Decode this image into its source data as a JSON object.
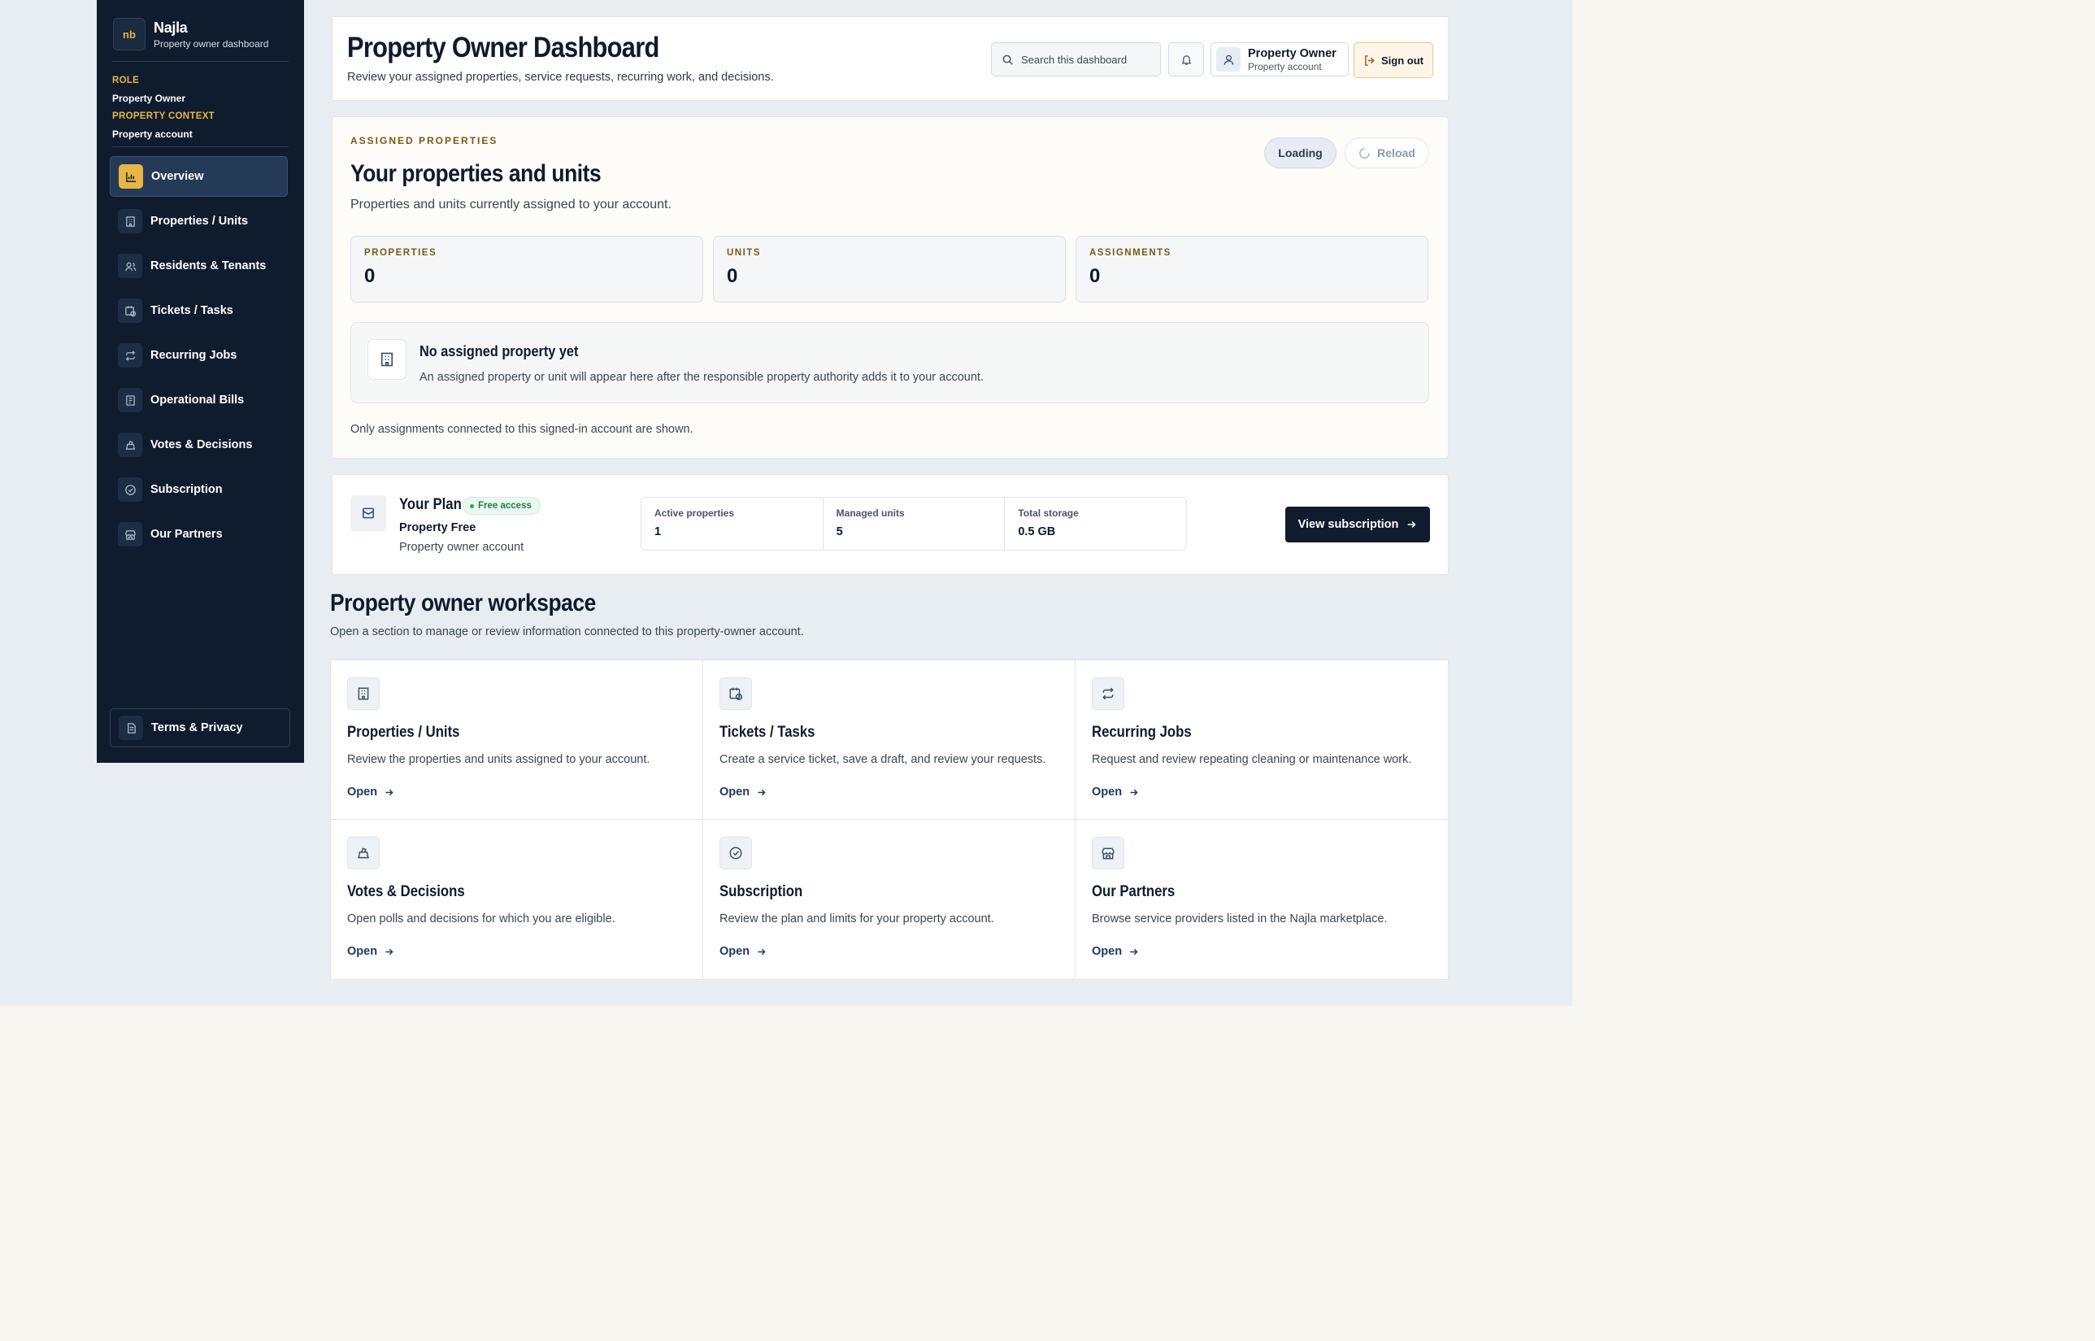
{
  "sidebar": {
    "brand_mark": "nb",
    "brand_name": "Najla",
    "brand_sub": "Property owner dashboard",
    "role_label": "ROLE",
    "role_value": "Property Owner",
    "context_label": "PROPERTY CONTEXT",
    "context_value": "Property account",
    "items": [
      {
        "label": "Overview",
        "icon": "chart-icon",
        "active": true
      },
      {
        "label": "Properties / Units",
        "icon": "building-icon"
      },
      {
        "label": "Residents & Tenants",
        "icon": "users-icon"
      },
      {
        "label": "Tickets / Tasks",
        "icon": "calendar-clock-icon"
      },
      {
        "label": "Recurring Jobs",
        "icon": "repeat-icon"
      },
      {
        "label": "Operational Bills",
        "icon": "receipt-icon"
      },
      {
        "label": "Votes & Decisions",
        "icon": "ballot-icon"
      },
      {
        "label": "Subscription",
        "icon": "check-circle-icon"
      },
      {
        "label": "Our Partners",
        "icon": "store-icon"
      }
    ],
    "terms_label": "Terms & Privacy"
  },
  "header": {
    "title": "Property Owner Dashboard",
    "subtitle": "Review your assigned properties, service requests, recurring work, and decisions.",
    "search_placeholder": "Search this dashboard",
    "user_name": "Property Owner",
    "user_sub": "Property account",
    "signout_label": "Sign out"
  },
  "assigned": {
    "eyebrow": "ASSIGNED PROPERTIES",
    "title": "Your properties and units",
    "subtitle": "Properties and units currently assigned to your account.",
    "loading_label": "Loading",
    "reload_label": "Reload",
    "stats": [
      {
        "label": "PROPERTIES",
        "value": "0"
      },
      {
        "label": "UNITS",
        "value": "0"
      },
      {
        "label": "ASSIGNMENTS",
        "value": "0"
      }
    ],
    "empty_title": "No assigned property yet",
    "empty_sub": "An assigned property or unit will appear here after the responsible property authority adds it to your account.",
    "footnote": "Only assignments connected to this signed-in account are shown."
  },
  "plan": {
    "title": "Your Plan",
    "badge": "Free access",
    "name": "Property Free",
    "sub": "Property owner account",
    "stats": [
      {
        "label": "Active properties",
        "value": "1"
      },
      {
        "label": "Managed units",
        "value": "5"
      },
      {
        "label": "Total storage",
        "value": "0.5 GB"
      }
    ],
    "button_label": "View subscription"
  },
  "workspace": {
    "title": "Property owner workspace",
    "subtitle": "Open a section to manage or review information connected to this property-owner account.",
    "cards": [
      {
        "title": "Properties / Units",
        "desc": "Review the properties and units assigned to your account.",
        "open": "Open",
        "icon": "building-icon"
      },
      {
        "title": "Tickets / Tasks",
        "desc": "Create a service ticket, save a draft, and review your requests.",
        "open": "Open",
        "icon": "calendar-clock-icon"
      },
      {
        "title": "Recurring Jobs",
        "desc": "Request and review repeating cleaning or maintenance work.",
        "open": "Open",
        "icon": "repeat-icon"
      },
      {
        "title": "Votes & Decisions",
        "desc": "Open polls and decisions for which you are eligible.",
        "open": "Open",
        "icon": "ballot-icon"
      },
      {
        "title": "Subscription",
        "desc": "Review the plan and limits for your property account.",
        "open": "Open",
        "icon": "check-circle-icon"
      },
      {
        "title": "Our Partners",
        "desc": "Browse service providers listed in the Najla marketplace.",
        "open": "Open",
        "icon": "store-icon"
      }
    ]
  },
  "colors": {
    "sidebar_bg": "#0f1c2e",
    "accent_gold": "#e9b546",
    "page_bg": "#e8edf1",
    "free_badge": "#20804a"
  }
}
